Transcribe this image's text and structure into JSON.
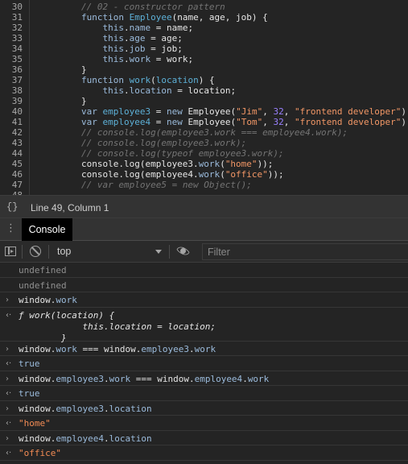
{
  "editor": {
    "lines": [
      {
        "num": "30",
        "tokens": [
          {
            "t": "        "
          },
          {
            "t": "// 02 - constructor pattern",
            "c": "cm"
          }
        ]
      },
      {
        "num": "31",
        "tokens": [
          {
            "t": "        "
          },
          {
            "t": "function",
            "c": "kw"
          },
          {
            "t": " "
          },
          {
            "t": "Employee",
            "c": "fn"
          },
          {
            "t": "(name, age, job) {"
          }
        ]
      },
      {
        "num": "32",
        "tokens": [
          {
            "t": "            "
          },
          {
            "t": "this",
            "c": "kw"
          },
          {
            "t": "."
          },
          {
            "t": "name",
            "c": "prop"
          },
          {
            "t": " = name;"
          }
        ]
      },
      {
        "num": "33",
        "tokens": [
          {
            "t": "            "
          },
          {
            "t": "this",
            "c": "kw"
          },
          {
            "t": "."
          },
          {
            "t": "age",
            "c": "prop"
          },
          {
            "t": " = age;"
          }
        ]
      },
      {
        "num": "34",
        "tokens": [
          {
            "t": "            "
          },
          {
            "t": "this",
            "c": "kw"
          },
          {
            "t": "."
          },
          {
            "t": "job",
            "c": "prop"
          },
          {
            "t": " = job;"
          }
        ]
      },
      {
        "num": "35",
        "tokens": [
          {
            "t": "            "
          },
          {
            "t": "this",
            "c": "kw"
          },
          {
            "t": "."
          },
          {
            "t": "work",
            "c": "prop"
          },
          {
            "t": " = work;"
          }
        ]
      },
      {
        "num": "36",
        "tokens": [
          {
            "t": "        }"
          }
        ]
      },
      {
        "num": "37",
        "tokens": [
          {
            "t": "        "
          },
          {
            "t": "function",
            "c": "kw"
          },
          {
            "t": " "
          },
          {
            "t": "work",
            "c": "fn"
          },
          {
            "t": "("
          },
          {
            "t": "location",
            "c": "fn"
          },
          {
            "t": ") {"
          }
        ]
      },
      {
        "num": "38",
        "tokens": [
          {
            "t": "            "
          },
          {
            "t": "this",
            "c": "kw"
          },
          {
            "t": "."
          },
          {
            "t": "location",
            "c": "prop"
          },
          {
            "t": " = location;"
          }
        ]
      },
      {
        "num": "39",
        "tokens": [
          {
            "t": "        }"
          }
        ]
      },
      {
        "num": "40",
        "tokens": [
          {
            "t": "        "
          },
          {
            "t": "var",
            "c": "kw"
          },
          {
            "t": " "
          },
          {
            "t": "employee3",
            "c": "fn"
          },
          {
            "t": " = "
          },
          {
            "t": "new",
            "c": "kw"
          },
          {
            "t": " Employee("
          },
          {
            "t": "\"Jim\"",
            "c": "str"
          },
          {
            "t": ", "
          },
          {
            "t": "32",
            "c": "num"
          },
          {
            "t": ", "
          },
          {
            "t": "\"frontend developer\"",
            "c": "str"
          },
          {
            "t": ");"
          }
        ]
      },
      {
        "num": "41",
        "tokens": [
          {
            "t": "        "
          },
          {
            "t": "var",
            "c": "kw"
          },
          {
            "t": " "
          },
          {
            "t": "employee4",
            "c": "fn"
          },
          {
            "t": " = "
          },
          {
            "t": "new",
            "c": "kw"
          },
          {
            "t": " Employee("
          },
          {
            "t": "\"Tom\"",
            "c": "str"
          },
          {
            "t": ", "
          },
          {
            "t": "32",
            "c": "num"
          },
          {
            "t": ", "
          },
          {
            "t": "\"frontend developer\"",
            "c": "str"
          },
          {
            "t": ");"
          }
        ]
      },
      {
        "num": "42",
        "tokens": [
          {
            "t": "        "
          },
          {
            "t": "// console.log(employee3.work === employee4.work);",
            "c": "cm"
          }
        ]
      },
      {
        "num": "43",
        "tokens": [
          {
            "t": "        "
          },
          {
            "t": "// console.log(employee3.work);",
            "c": "cm"
          }
        ]
      },
      {
        "num": "44",
        "tokens": [
          {
            "t": "        "
          },
          {
            "t": "// console.log(typeof employee3.work);",
            "c": "cm"
          }
        ]
      },
      {
        "num": "45",
        "tokens": [
          {
            "t": "        console.log(employee3."
          },
          {
            "t": "work",
            "c": "prop"
          },
          {
            "t": "("
          },
          {
            "t": "\"home\"",
            "c": "str"
          },
          {
            "t": "));"
          }
        ]
      },
      {
        "num": "46",
        "tokens": [
          {
            "t": "        console.log(employee4."
          },
          {
            "t": "work",
            "c": "prop"
          },
          {
            "t": "("
          },
          {
            "t": "\"office\"",
            "c": "str"
          },
          {
            "t": "));"
          }
        ]
      },
      {
        "num": "47",
        "tokens": [
          {
            "t": "        "
          },
          {
            "t": "// var employee5 = new Object();",
            "c": "cm"
          }
        ]
      },
      {
        "num": "48",
        "tokens": [
          {
            "t": ""
          }
        ]
      }
    ]
  },
  "statusbar": {
    "braces_icon": "{}",
    "position": "Line 49, Column 1"
  },
  "drawer": {
    "menu_icon": "⋮",
    "tab_label": "Console"
  },
  "console_toolbar": {
    "context": "top",
    "filter_placeholder": "Filter"
  },
  "console": {
    "messages": [
      {
        "kind": "plain",
        "glyph": "",
        "text": "undefined"
      },
      {
        "kind": "plain",
        "glyph": "",
        "text": "undefined"
      },
      {
        "kind": "input",
        "glyph": "›",
        "tokens": [
          {
            "t": "window."
          },
          {
            "t": "work",
            "c": "p-prop"
          }
        ]
      },
      {
        "kind": "func",
        "glyph": "‹·",
        "lines": [
          "ƒ work(location) {",
          "            this.location = location;",
          "        }"
        ]
      },
      {
        "kind": "input",
        "glyph": "›",
        "tokens": [
          {
            "t": "window."
          },
          {
            "t": "work",
            "c": "p-prop"
          },
          {
            "t": " === window."
          },
          {
            "t": "employee3",
            "c": "p-prop"
          },
          {
            "t": "."
          },
          {
            "t": "work",
            "c": "p-prop"
          }
        ]
      },
      {
        "kind": "output",
        "glyph": "‹·",
        "tokens": [
          {
            "t": "true",
            "c": "out-bool"
          }
        ]
      },
      {
        "kind": "input",
        "glyph": "›",
        "tokens": [
          {
            "t": "window."
          },
          {
            "t": "employee3",
            "c": "p-prop"
          },
          {
            "t": "."
          },
          {
            "t": "work",
            "c": "p-prop"
          },
          {
            "t": " === window."
          },
          {
            "t": "employee4",
            "c": "p-prop"
          },
          {
            "t": "."
          },
          {
            "t": "work",
            "c": "p-prop"
          }
        ]
      },
      {
        "kind": "output",
        "glyph": "‹·",
        "tokens": [
          {
            "t": "true",
            "c": "out-bool"
          }
        ]
      },
      {
        "kind": "input",
        "glyph": "›",
        "tokens": [
          {
            "t": "window."
          },
          {
            "t": "employee3",
            "c": "p-prop"
          },
          {
            "t": "."
          },
          {
            "t": "location",
            "c": "p-prop"
          }
        ]
      },
      {
        "kind": "output",
        "glyph": "‹·",
        "tokens": [
          {
            "t": "\"home\"",
            "c": "out-str"
          }
        ]
      },
      {
        "kind": "input",
        "glyph": "›",
        "tokens": [
          {
            "t": "window."
          },
          {
            "t": "employee4",
            "c": "p-prop"
          },
          {
            "t": "."
          },
          {
            "t": "location",
            "c": "p-prop"
          }
        ]
      },
      {
        "kind": "output",
        "glyph": "‹·",
        "tokens": [
          {
            "t": "\"office\"",
            "c": "out-str"
          }
        ]
      }
    ]
  },
  "colors": {
    "background": "#242424",
    "keyword": "#9bbbdc",
    "function_name": "#5db0d7",
    "string": "#f29766",
    "number": "#9980ff",
    "comment": "#747474",
    "tab_active_bg": "#000000"
  },
  "icons": {
    "toggle_sidebar": "sidebar-toggle-icon",
    "clear_console": "clear-console-icon",
    "live_expression": "eye-icon",
    "context_dropdown": "chevron-down-icon"
  }
}
